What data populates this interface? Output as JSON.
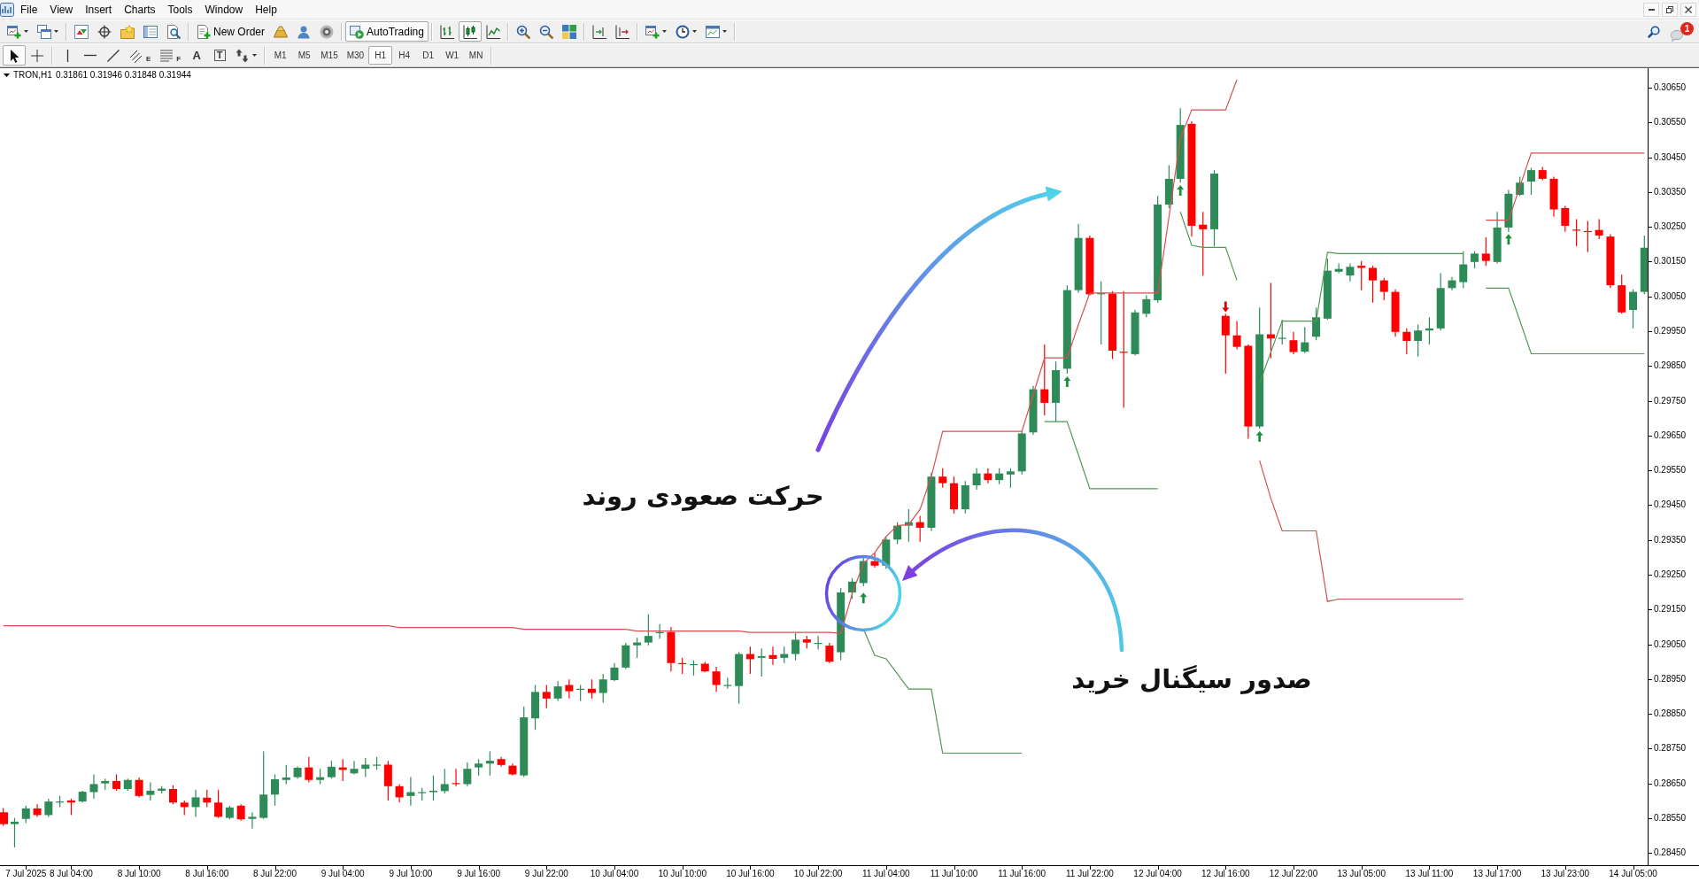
{
  "menu": {
    "items": [
      "File",
      "View",
      "Insert",
      "Charts",
      "Tools",
      "Window",
      "Help"
    ]
  },
  "toolbar": {
    "new_order": "New Order",
    "autotrading": {
      "label": "AutoTrading",
      "on": true
    },
    "chart_types": [
      {
        "kind": "bars",
        "selected": false
      },
      {
        "kind": "candles",
        "selected": true
      },
      {
        "kind": "line",
        "selected": false
      }
    ]
  },
  "notifications": {
    "count": "1"
  },
  "drawing_tools": [
    {
      "kind": "cursor",
      "selected": true
    },
    {
      "kind": "crosshair",
      "selected": false
    },
    {
      "kind": "vertical_line",
      "selected": false
    },
    {
      "kind": "horizontal_line",
      "selected": false
    },
    {
      "kind": "trend_line",
      "selected": false
    },
    {
      "kind": "channel",
      "glyph": "E",
      "selected": false
    },
    {
      "kind": "fibonacci",
      "glyph": "F",
      "selected": false
    },
    {
      "kind": "text",
      "glyph": "A",
      "selected": false
    },
    {
      "kind": "label",
      "glyph": "T",
      "selected": false
    },
    {
      "kind": "arrows",
      "selected": false
    }
  ],
  "timeframes": [
    {
      "label": "M1",
      "selected": false
    },
    {
      "label": "M5",
      "selected": false
    },
    {
      "label": "M15",
      "selected": false
    },
    {
      "label": "M30",
      "selected": false
    },
    {
      "label": "H1",
      "selected": true
    },
    {
      "label": "H4",
      "selected": false
    },
    {
      "label": "D1",
      "selected": false
    },
    {
      "label": "W1",
      "selected": false
    },
    {
      "label": "MN",
      "selected": false
    }
  ],
  "chart": {
    "symbol": "TRON,H1",
    "quote": "0.31861 0.31946 0.31848 0.31944",
    "chart_data": [
      {
        "type": "candlestick",
        "categories": [
          null,
          null,
          "7 Jul 2025",
          null,
          null,
          null,
          "8 Jul 04:00",
          null,
          null,
          null,
          null,
          null,
          "8 Jul 10:00",
          null,
          null,
          null,
          null,
          null,
          "8 Jul 16:00",
          null,
          null,
          null,
          null,
          null,
          "8 Jul 22:00",
          null,
          null,
          null,
          null,
          null,
          "9 Jul 04:00",
          null,
          null,
          null,
          null,
          null,
          "9 Jul 10:00",
          null,
          null,
          null,
          null,
          null,
          "9 Jul 16:00",
          null,
          null,
          null,
          null,
          null,
          "9 Jul 22:00",
          null,
          null,
          null,
          null,
          null,
          "10 Jul 04:00",
          null,
          null,
          null,
          null,
          null,
          "10 Jul 10:00",
          null,
          null,
          null,
          null,
          null,
          "10 Jul 16:00",
          null,
          null,
          null,
          null,
          null,
          "10 Jul 22:00",
          null,
          null,
          null,
          null,
          null,
          "11 Jul 04:00",
          null,
          null,
          null,
          null,
          null,
          "11 Jul 10:00",
          null,
          null,
          null,
          null,
          null,
          "11 Jul 16:00",
          null,
          null,
          null,
          null,
          null,
          "11 Jul 22:00",
          null,
          null,
          null,
          null,
          null,
          "12 Jul 04:00",
          null,
          null,
          null,
          null,
          null,
          "12 Jul 16:00",
          null,
          null,
          null,
          null,
          null,
          "12 Jul 22:00",
          null,
          null,
          null,
          null,
          null,
          "13 Jul 05:00",
          null,
          null,
          null,
          null,
          null,
          "13 Jul 11:00",
          null,
          null,
          null,
          null,
          null,
          "13 Jul 17:00",
          null,
          null,
          null,
          null,
          null,
          "13 Jul 23:00",
          null,
          null,
          null,
          null,
          null,
          "14 Jul 05:00",
          null
        ],
        "ohlc": [
          [
            0.28567,
            0.28579,
            0.28528,
            0.28533
          ],
          [
            0.28533,
            0.28551,
            0.28466,
            0.2854
          ],
          [
            0.28548,
            0.28586,
            0.28536,
            0.28578
          ],
          [
            0.28578,
            0.2859,
            0.28554,
            0.28559
          ],
          [
            0.28559,
            0.28606,
            0.28554,
            0.28598
          ],
          [
            0.28596,
            0.28614,
            0.28582,
            0.28598
          ],
          [
            0.28601,
            0.28606,
            0.28559,
            0.28595
          ],
          [
            0.28598,
            0.28629,
            0.28595,
            0.28626
          ],
          [
            0.28625,
            0.28676,
            0.28606,
            0.28648
          ],
          [
            0.2865,
            0.28664,
            0.28632,
            0.28657
          ],
          [
            0.28657,
            0.28676,
            0.28629,
            0.28634
          ],
          [
            0.28634,
            0.28664,
            0.28629,
            0.2866
          ],
          [
            0.2866,
            0.28667,
            0.2861,
            0.28614
          ],
          [
            0.28617,
            0.28653,
            0.28601,
            0.28629
          ],
          [
            0.28629,
            0.28642,
            0.28621,
            0.28635
          ],
          [
            0.28634,
            0.28645,
            0.2859,
            0.28595
          ],
          [
            0.28595,
            0.28601,
            0.28559,
            0.28582
          ],
          [
            0.28582,
            0.28632,
            0.28554,
            0.2861
          ],
          [
            0.28609,
            0.28632,
            0.28582,
            0.28595
          ],
          [
            0.28595,
            0.28632,
            0.28551,
            0.28554
          ],
          [
            0.28551,
            0.28586,
            0.28547,
            0.28581
          ],
          [
            0.28586,
            0.2859,
            0.28543,
            0.28547
          ],
          [
            0.28548,
            0.28567,
            0.2852,
            0.28554
          ],
          [
            0.28551,
            0.28742,
            0.28548,
            0.28618
          ],
          [
            0.28618,
            0.28676,
            0.28586,
            0.28662
          ],
          [
            0.2866,
            0.28703,
            0.28648,
            0.28667
          ],
          [
            0.28668,
            0.28699,
            0.28664,
            0.28695
          ],
          [
            0.28696,
            0.28726,
            0.28653,
            0.2866
          ],
          [
            0.2866,
            0.28692,
            0.28648,
            0.28668
          ],
          [
            0.28668,
            0.28715,
            0.28664,
            0.28698
          ],
          [
            0.28696,
            0.2872,
            0.28657,
            0.28689
          ],
          [
            0.28679,
            0.28715,
            0.28676,
            0.28692
          ],
          [
            0.28692,
            0.28723,
            0.28668,
            0.28704
          ],
          [
            0.28703,
            0.28726,
            0.28689,
            0.28704
          ],
          [
            0.28704,
            0.28715,
            0.28601,
            0.28642
          ],
          [
            0.28642,
            0.28648,
            0.28595,
            0.2861
          ],
          [
            0.28614,
            0.28668,
            0.28586,
            0.28625
          ],
          [
            0.28623,
            0.28637,
            0.28601,
            0.28625
          ],
          [
            0.28625,
            0.28673,
            0.28601,
            0.28629
          ],
          [
            0.28628,
            0.28692,
            0.28621,
            0.28648
          ],
          [
            0.28651,
            0.28692,
            0.28642,
            0.28648
          ],
          [
            0.28648,
            0.2871,
            0.28642,
            0.28692
          ],
          [
            0.28696,
            0.2872,
            0.28673,
            0.28707
          ],
          [
            0.28707,
            0.28742,
            0.28673,
            0.28715
          ],
          [
            0.2872,
            0.28726,
            0.28698,
            0.28703
          ],
          [
            0.28701,
            0.28707,
            0.28673,
            0.28676
          ],
          [
            0.28673,
            0.28871,
            0.28668,
            0.2884
          ],
          [
            0.28837,
            0.28933,
            0.28804,
            0.28913
          ],
          [
            0.28913,
            0.28933,
            0.28866,
            0.28894
          ],
          [
            0.28894,
            0.28944,
            0.28887,
            0.28929
          ],
          [
            0.28933,
            0.28949,
            0.28894,
            0.28915
          ],
          [
            0.28921,
            0.28933,
            0.28887,
            0.28922
          ],
          [
            0.28922,
            0.28949,
            0.28894,
            0.2891
          ],
          [
            0.2891,
            0.28965,
            0.28882,
            0.28949
          ],
          [
            0.28947,
            0.28996,
            0.28944,
            0.28983
          ],
          [
            0.28983,
            0.29054,
            0.28979,
            0.29047
          ],
          [
            0.29047,
            0.29069,
            0.29011,
            0.29055
          ],
          [
            0.29055,
            0.29136,
            0.29047,
            0.29074
          ],
          [
            0.29083,
            0.29108,
            0.29066,
            0.29085
          ],
          [
            0.29085,
            0.291,
            0.28972,
            0.28996
          ],
          [
            0.28996,
            0.29011,
            0.28965,
            0.28994
          ],
          [
            0.28991,
            0.29004,
            0.2896,
            0.28993
          ],
          [
            0.28994,
            0.28999,
            0.28969,
            0.28972
          ],
          [
            0.28972,
            0.28985,
            0.28913,
            0.28933
          ],
          [
            0.28932,
            0.28954,
            0.28922,
            0.28933
          ],
          [
            0.2893,
            0.29027,
            0.28879,
            0.29022
          ],
          [
            0.29022,
            0.29043,
            0.28965,
            0.29007
          ],
          [
            0.29011,
            0.29038,
            0.28957,
            0.29016
          ],
          [
            0.29019,
            0.29043,
            0.28991,
            0.29008
          ],
          [
            0.29011,
            0.29043,
            0.28996,
            0.29022
          ],
          [
            0.29022,
            0.29082,
            0.29004,
            0.29063
          ],
          [
            0.29064,
            0.29074,
            0.29038,
            0.29055
          ],
          [
            0.29052,
            0.29074,
            0.29035,
            0.29054
          ],
          [
            0.29046,
            0.29054,
            0.28996,
            0.29
          ],
          [
            0.29027,
            0.29211,
            0.29004,
            0.29199
          ],
          [
            0.29199,
            0.2924,
            0.2918,
            0.2923
          ],
          [
            0.29226,
            0.29298,
            0.29217,
            0.29289
          ],
          [
            0.29289,
            0.29313,
            0.2927,
            0.29276
          ],
          [
            0.29276,
            0.2936,
            0.29267,
            0.29351
          ],
          [
            0.29351,
            0.29401,
            0.29338,
            0.29391
          ],
          [
            0.29391,
            0.29438,
            0.29345,
            0.29401
          ],
          [
            0.29401,
            0.29419,
            0.29345,
            0.29385
          ],
          [
            0.29385,
            0.29544,
            0.29376,
            0.29532
          ],
          [
            0.29532,
            0.29556,
            0.295,
            0.29513
          ],
          [
            0.29513,
            0.29532,
            0.29426,
            0.29438
          ],
          [
            0.29438,
            0.29519,
            0.29426,
            0.29507
          ],
          [
            0.29507,
            0.29556,
            0.29494,
            0.29541
          ],
          [
            0.29541,
            0.29556,
            0.29513,
            0.29522
          ],
          [
            0.29522,
            0.29556,
            0.2951,
            0.29541
          ],
          [
            0.29538,
            0.29556,
            0.295,
            0.29547
          ],
          [
            0.29547,
            0.29662,
            0.29538,
            0.29656
          ],
          [
            0.29659,
            0.29793,
            0.29652,
            0.29783
          ],
          [
            0.29783,
            0.29912,
            0.29708,
            0.29744
          ],
          [
            0.29744,
            0.29863,
            0.2969,
            0.29838
          ],
          [
            0.29842,
            0.30082,
            0.29828,
            0.30068
          ],
          [
            0.30068,
            0.30258,
            0.30061,
            0.30218
          ],
          [
            0.30218,
            0.30225,
            0.30053,
            0.30056
          ],
          [
            0.30056,
            0.30093,
            0.29912,
            0.30059
          ],
          [
            0.30058,
            0.30065,
            0.2987,
            0.29894
          ],
          [
            0.29891,
            0.30065,
            0.2973,
            0.2989
          ],
          [
            0.29884,
            0.30011,
            0.2988,
            0.30004
          ],
          [
            0.3,
            0.30053,
            0.2999,
            0.30042
          ],
          [
            0.30039,
            0.30339,
            0.30032,
            0.30314
          ],
          [
            0.30314,
            0.30427,
            0.30304,
            0.30388
          ],
          [
            0.30388,
            0.30591,
            0.30377,
            0.30543
          ],
          [
            0.30546,
            0.30553,
            0.30222,
            0.30253
          ],
          [
            0.30256,
            0.30293,
            0.3011,
            0.30243
          ],
          [
            0.30243,
            0.30413,
            0.30194,
            0.30403
          ],
          [
            0.29994,
            0.3,
            0.29828,
            0.29938
          ],
          [
            0.29938,
            0.29979,
            0.29898,
            0.29905
          ],
          [
            0.29908,
            0.29912,
            0.29641,
            0.29676
          ],
          [
            0.29676,
            0.30018,
            0.2967,
            0.29941
          ],
          [
            0.29941,
            0.30089,
            0.29872,
            0.29929
          ],
          [
            0.29928,
            0.29983,
            0.29912,
            0.29931
          ],
          [
            0.29924,
            0.29948,
            0.29884,
            0.2989
          ],
          [
            0.29891,
            0.29962,
            0.29887,
            0.29918
          ],
          [
            0.29934,
            0.30018,
            0.29924,
            0.2999
          ],
          [
            0.29986,
            0.30159,
            0.29983,
            0.30124
          ],
          [
            0.30121,
            0.30145,
            0.30117,
            0.30129
          ],
          [
            0.3011,
            0.30145,
            0.30093,
            0.30135
          ],
          [
            0.30138,
            0.30152,
            0.30068,
            0.30132
          ],
          [
            0.30132,
            0.30138,
            0.30032,
            0.30096
          ],
          [
            0.30096,
            0.30103,
            0.30039,
            0.30063
          ],
          [
            0.30063,
            0.3007,
            0.29934,
            0.29948
          ],
          [
            0.29948,
            0.29958,
            0.29884,
            0.29922
          ],
          [
            0.29922,
            0.29969,
            0.29877,
            0.29952
          ],
          [
            0.29952,
            0.2999,
            0.29912,
            0.29958
          ],
          [
            0.29958,
            0.30117,
            0.29952,
            0.30074
          ],
          [
            0.30074,
            0.30105,
            0.30068,
            0.30096
          ],
          [
            0.30091,
            0.3018,
            0.30074,
            0.30142
          ],
          [
            0.30149,
            0.3018,
            0.30131,
            0.30173
          ],
          [
            0.30173,
            0.3022,
            0.30138,
            0.30152
          ],
          [
            0.30149,
            0.30293,
            0.30145,
            0.30248
          ],
          [
            0.30248,
            0.30356,
            0.30236,
            0.30345
          ],
          [
            0.30342,
            0.30394,
            0.30338,
            0.30377
          ],
          [
            0.3038,
            0.3042,
            0.30342,
            0.30413
          ],
          [
            0.30413,
            0.30422,
            0.30384,
            0.30388
          ],
          [
            0.30388,
            0.30394,
            0.30279,
            0.303
          ],
          [
            0.30304,
            0.3031,
            0.30236,
            0.30253
          ],
          [
            0.30242,
            0.30272,
            0.30194,
            0.30239
          ],
          [
            0.30238,
            0.30267,
            0.30177,
            0.30235
          ],
          [
            0.30241,
            0.30272,
            0.30215,
            0.30225
          ],
          [
            0.30222,
            0.30229,
            0.30074,
            0.30082
          ],
          [
            0.30082,
            0.30113,
            0.3,
            0.30004
          ],
          [
            0.30011,
            0.3007,
            0.29958,
            0.30063
          ],
          [
            0.30063,
            0.30225,
            0.30056,
            0.3019
          ]
        ],
        "ylim": [
          0.28415,
          0.30706
        ],
        "yticks": [
          {
            "value": 0.2845,
            "label": "0.28450"
          },
          {
            "value": 0.2855,
            "label": "0.28550"
          },
          {
            "value": 0.2865,
            "label": "0.28650"
          },
          {
            "value": 0.2875,
            "label": "0.28750"
          },
          {
            "value": 0.2885,
            "label": "0.28850"
          },
          {
            "value": 0.2895,
            "label": "0.28950"
          },
          {
            "value": 0.2905,
            "label": "0.29050"
          },
          {
            "value": 0.2915,
            "label": "0.29150"
          },
          {
            "value": 0.2925,
            "label": "0.29250"
          },
          {
            "value": 0.2935,
            "label": "0.29350"
          },
          {
            "value": 0.2945,
            "label": "0.29450"
          },
          {
            "value": 0.2955,
            "label": "0.29550"
          },
          {
            "value": 0.2965,
            "label": "0.29650"
          },
          {
            "value": 0.2975,
            "label": "0.29750"
          },
          {
            "value": 0.2985,
            "label": "0.29850"
          },
          {
            "value": 0.2995,
            "label": "0.29950"
          },
          {
            "value": 0.3005,
            "label": "0.30050"
          },
          {
            "value": 0.3015,
            "label": "0.30150"
          },
          {
            "value": 0.3025,
            "label": "0.30250"
          },
          {
            "value": 0.3035,
            "label": "0.30350"
          },
          {
            "value": 0.3045,
            "label": "0.30450"
          },
          {
            "value": 0.3055,
            "label": "0.30550"
          },
          {
            "value": 0.3065,
            "label": "0.30650"
          }
        ],
        "series": [
          {
            "type": "line",
            "color": "#d65050",
            "values": [
              0.29103,
              0.29103,
              0.29103,
              0.29103,
              0.29103,
              0.29103,
              0.29103,
              0.29103,
              0.29103,
              0.29103,
              0.29103,
              0.29103,
              0.29103,
              0.29103,
              0.29103,
              0.29103,
              0.29103,
              0.29103,
              0.29103,
              0.29103,
              0.29103,
              0.29103,
              0.29103,
              0.29103,
              0.29103,
              0.29103,
              0.29103,
              0.29103,
              0.29103,
              0.29103,
              0.29103,
              0.29103,
              0.29103,
              0.29103,
              0.29103,
              0.29098,
              0.29098,
              0.29098,
              0.29098,
              0.29098,
              0.29098,
              0.29098,
              0.29098,
              0.29098,
              0.29098,
              0.29098,
              0.29093,
              0.29093,
              0.29093,
              0.29093,
              0.29093,
              0.29093,
              0.29093,
              0.29093,
              0.29093,
              0.29093,
              0.29088,
              0.29088,
              0.29088,
              0.29088,
              0.29088,
              0.29088,
              0.29088,
              0.29088,
              0.29088,
              0.29088,
              0.29084,
              0.29084,
              0.29084,
              0.29084,
              0.29084,
              0.29084,
              0.29084,
              0.29084,
              0.29082,
              0.29195,
              0.29282,
              0.29313,
              0.2936,
              0.29391,
              0.29394,
              0.29438,
              0.29532,
              0.29662,
              0.29662,
              0.29662,
              0.29662,
              0.29662,
              0.29662,
              0.29662,
              0.29662,
              0.29768,
              0.29873,
              0.29873,
              0.29873,
              0.29969,
              0.3006,
              0.3006,
              0.3006,
              0.3006,
              0.3006,
              0.3006,
              0.3006,
              0.30279,
              0.30504,
              0.30586,
              0.30586,
              0.30586,
              0.30586,
              0.30673,
              null,
              0.29578,
              0.29469,
              0.29376,
              0.29376,
              0.29376,
              0.29376,
              0.29173,
              0.2918,
              0.2918,
              0.2918,
              0.2918,
              0.2918,
              0.2918,
              0.2918,
              0.2918,
              0.2918,
              0.2918,
              0.2918,
              0.2918,
              null,
              0.30269,
              0.30269,
              0.30269,
              0.30366,
              0.30462,
              0.30462,
              0.30462,
              0.30462,
              0.30462,
              0.30462,
              0.30462,
              0.30462,
              0.30462,
              0.30462,
              0.30462
            ]
          },
          {
            "type": "line",
            "color": "#4f9a4f",
            "values": [
              null,
              null,
              null,
              null,
              null,
              null,
              null,
              null,
              null,
              null,
              null,
              null,
              null,
              null,
              null,
              null,
              null,
              null,
              null,
              null,
              null,
              null,
              null,
              null,
              null,
              null,
              null,
              null,
              null,
              null,
              null,
              null,
              null,
              null,
              null,
              null,
              null,
              null,
              null,
              null,
              null,
              null,
              null,
              null,
              null,
              null,
              null,
              null,
              null,
              null,
              null,
              null,
              null,
              null,
              null,
              null,
              null,
              null,
              null,
              null,
              null,
              null,
              null,
              null,
              null,
              null,
              null,
              null,
              null,
              null,
              null,
              null,
              null,
              null,
              null,
              null,
              0.29095,
              0.29018,
              0.29008,
              0.28965,
              0.28921,
              0.28921,
              0.28921,
              0.28737,
              0.28737,
              0.28737,
              0.28737,
              0.28737,
              0.28737,
              0.28737,
              0.28737,
              null,
              0.2969,
              0.2969,
              0.2969,
              0.29594,
              0.29497,
              0.29497,
              0.29497,
              0.29497,
              0.29497,
              0.29497,
              0.29497,
              null,
              0.30293,
              0.30197,
              0.30191,
              0.30191,
              0.30191,
              0.30096,
              null,
              0.298,
              0.2989,
              0.29979,
              0.29979,
              0.29979,
              0.29979,
              0.30177,
              0.30173,
              0.30173,
              0.30173,
              0.30173,
              0.30173,
              0.30173,
              0.30173,
              0.30173,
              0.30173,
              0.30173,
              0.30173,
              0.30173,
              null,
              0.30074,
              0.30074,
              0.30074,
              0.2998,
              0.29885,
              0.29885,
              0.29885,
              0.29885,
              0.29885,
              0.29885,
              0.29885,
              0.29885,
              0.29885,
              0.29885,
              0.29885
            ]
          },
          {
            "type": "scatter",
            "color": "#1e8e3e",
            "values": [
              null,
              null,
              null,
              null,
              null,
              null,
              null,
              null,
              null,
              null,
              null,
              null,
              null,
              null,
              null,
              null,
              null,
              null,
              null,
              null,
              null,
              null,
              null,
              null,
              null,
              null,
              null,
              null,
              null,
              null,
              null,
              null,
              null,
              null,
              null,
              null,
              null,
              null,
              null,
              null,
              null,
              null,
              null,
              null,
              null,
              null,
              null,
              null,
              null,
              null,
              null,
              null,
              null,
              null,
              null,
              null,
              null,
              null,
              null,
              null,
              null,
              null,
              null,
              null,
              null,
              null,
              null,
              null,
              null,
              null,
              null,
              null,
              null,
              null,
              null,
              null,
              0.29183,
              null,
              null,
              null,
              null,
              null,
              null,
              null,
              null,
              null,
              null,
              null,
              null,
              null,
              null,
              null,
              null,
              null,
              0.29805,
              null,
              null,
              null,
              null,
              null,
              null,
              null,
              null,
              null,
              0.30355,
              null,
              null,
              null,
              null,
              null,
              null,
              0.29648,
              null,
              null,
              null,
              null,
              null,
              null,
              null,
              null,
              null,
              null,
              null,
              null,
              null,
              null,
              null,
              null,
              null,
              null,
              null,
              null,
              null,
              0.30214,
              null,
              null,
              null,
              null,
              null,
              null,
              null,
              null,
              null,
              null,
              null,
              null
            ]
          },
          {
            "type": "scatter",
            "color": "#e00000",
            "values": [
              null,
              null,
              null,
              null,
              null,
              null,
              null,
              null,
              null,
              null,
              null,
              null,
              null,
              null,
              null,
              null,
              null,
              null,
              null,
              null,
              null,
              null,
              null,
              null,
              null,
              null,
              null,
              null,
              null,
              null,
              null,
              null,
              null,
              null,
              null,
              null,
              null,
              null,
              null,
              null,
              null,
              null,
              null,
              null,
              null,
              null,
              null,
              null,
              null,
              null,
              null,
              null,
              null,
              null,
              null,
              null,
              null,
              null,
              null,
              null,
              null,
              null,
              null,
              null,
              null,
              null,
              null,
              null,
              null,
              null,
              null,
              null,
              null,
              null,
              null,
              null,
              null,
              null,
              null,
              null,
              null,
              null,
              null,
              null,
              null,
              null,
              null,
              null,
              null,
              null,
              null,
              null,
              null,
              null,
              null,
              null,
              null,
              null,
              null,
              null,
              null,
              null,
              null,
              null,
              null,
              null,
              null,
              null,
              0.3002,
              null,
              null,
              null,
              null,
              null,
              null,
              null,
              null,
              null,
              null,
              null,
              null,
              null,
              null,
              null,
              null,
              null,
              null,
              null,
              null,
              null,
              null,
              null,
              null,
              null,
              null,
              null,
              null,
              null,
              null,
              null,
              null,
              null,
              null,
              null,
              null,
              null
            ]
          }
        ]
      }
    ],
    "callouts": [
      "حرکت صعودی روند",
      "صدور سیگنال خرید"
    ]
  }
}
